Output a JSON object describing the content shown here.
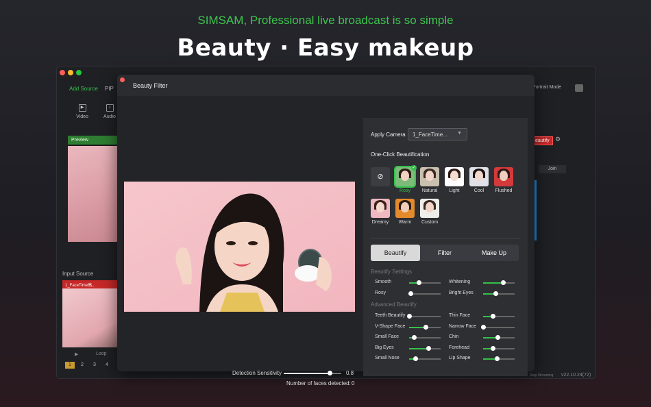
{
  "tagline": "SIMSAM, Professional live broadcast is so simple",
  "headline": "Beauty · Easy makeup",
  "app": {
    "tabs": [
      "Add Source",
      "PIP"
    ],
    "tiles": [
      {
        "label": "Video",
        "icon": "video-icon"
      },
      {
        "label": "Audio",
        "icon": "audio-icon"
      }
    ],
    "preview_label": "Preview",
    "input_source_label": "Input Source",
    "input_card_label": "1_FaceTime高...",
    "loop_label": "Loop",
    "pages": [
      "1",
      "2",
      "3",
      "4"
    ],
    "portrait_mode": "Portrait Mode",
    "beautify_chip": "eautify",
    "join_label": "Join",
    "stop_streaming": "Stop Streaming",
    "version": "v22.10.24(72)"
  },
  "dialog": {
    "title": "Beauty Filter",
    "apply_camera_label": "Apply Camera",
    "camera_value": "1_FaceTime...",
    "one_click_label": "One-Click Beautification",
    "presets": [
      {
        "label": "Rosy",
        "selected": true
      },
      {
        "label": "Natural",
        "selected": false
      },
      {
        "label": "Light",
        "selected": false
      },
      {
        "label": "Cool",
        "selected": false
      },
      {
        "label": "Flushed",
        "selected": false
      },
      {
        "label": "Dreamy",
        "selected": false
      },
      {
        "label": "Warm",
        "selected": false
      },
      {
        "label": "Custom",
        "selected": false
      }
    ],
    "tabs": [
      "Beautify",
      "Filter",
      "Make Up"
    ],
    "active_tab": "Beautify",
    "beautify_settings_label": "Beautify Settings",
    "advanced_label": "Advanced Beautify",
    "beautify_sliders": [
      {
        "label": "Smooth",
        "value": 0.3
      },
      {
        "label": "Whitening",
        "value": 0.63
      },
      {
        "label": "Rosy",
        "value": 0.05
      },
      {
        "label": "Bright Eyes",
        "value": 0.4
      }
    ],
    "advanced_sliders": [
      {
        "label": "Teeth Beautify",
        "value": 0.0
      },
      {
        "label": "Thin Face",
        "value": 0.3
      },
      {
        "label": "V-Shape Face",
        "value": 0.53
      },
      {
        "label": "Narrow Face",
        "value": 0.0
      },
      {
        "label": "Small Face",
        "value": 0.16
      },
      {
        "label": "Chin",
        "value": 0.45
      },
      {
        "label": "Big Eyes",
        "value": 0.6
      },
      {
        "label": "Forehead",
        "value": 0.3
      },
      {
        "label": "Small Nose",
        "value": 0.2
      },
      {
        "label": "Lip Shape",
        "value": 0.43
      }
    ],
    "sensitivity_label": "Detection Sensitivity",
    "sensitivity_value": "0.8",
    "faces_label": "Number of faces detected:",
    "faces_value": "0"
  },
  "colors": {
    "accent": "#35c04a",
    "record": "#c62828",
    "link": "#1e88e5"
  }
}
